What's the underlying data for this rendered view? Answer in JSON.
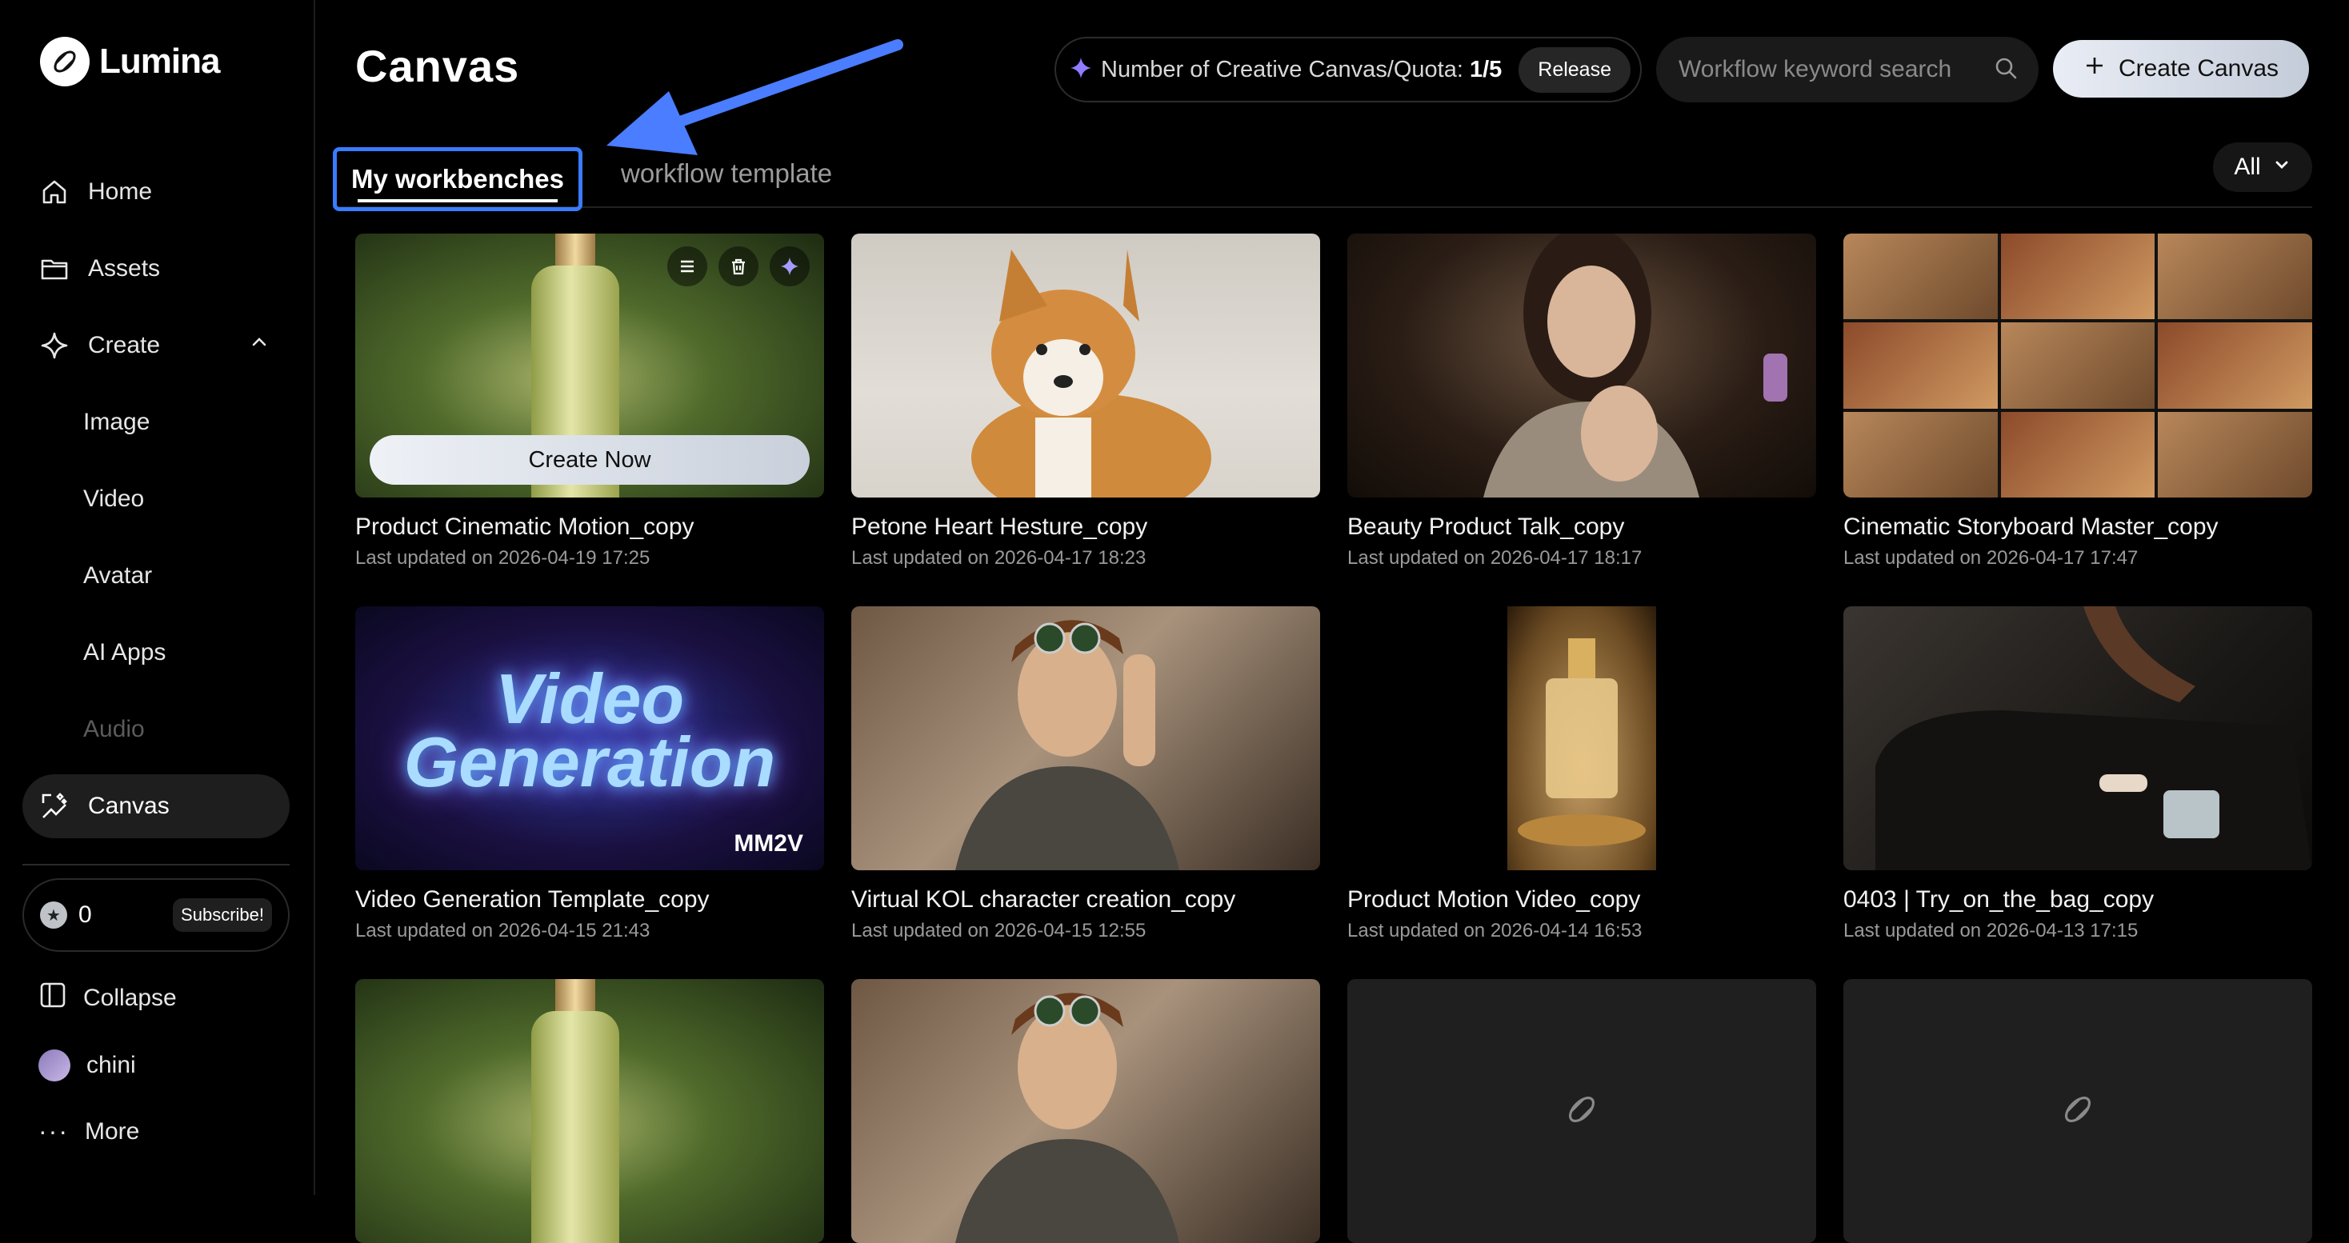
{
  "brand": {
    "name": "Lumina"
  },
  "sidebar": {
    "items": [
      {
        "label": "Home",
        "icon": "home-icon"
      },
      {
        "label": "Assets",
        "icon": "folder-icon"
      },
      {
        "label": "Create",
        "icon": "sparkle-icon"
      },
      {
        "label": "Image"
      },
      {
        "label": "Video"
      },
      {
        "label": "Avatar"
      },
      {
        "label": "AI Apps"
      },
      {
        "label": "Audio"
      },
      {
        "label": "Canvas",
        "icon": "canvas-icon"
      }
    ],
    "credits": {
      "count": "0",
      "subscribe_label": "Subscribe!"
    },
    "collapse_label": "Collapse",
    "user_name": "chini",
    "more_label": "More"
  },
  "header": {
    "title": "Canvas",
    "quota_label": "Number of Creative Canvas/Quota:",
    "quota_value": "1/5",
    "release_label": "Release",
    "search_placeholder": "Workflow keyword search",
    "create_label": "Create Canvas"
  },
  "tabs": {
    "active": "My workbenches",
    "inactive": "workflow template",
    "filter": "All"
  },
  "cards": [
    {
      "title": "Product Cinematic Motion_copy",
      "date": "Last updated on 2026-04-19 17:25",
      "action": "Create Now"
    },
    {
      "title": "Petone Heart Hesture_copy",
      "date": "Last updated on 2026-04-17 18:23"
    },
    {
      "title": "Beauty Product Talk_copy",
      "date": "Last updated on 2026-04-17 18:17"
    },
    {
      "title": "Cinematic Storyboard Master_copy",
      "date": "Last updated on 2026-04-17 17:47"
    },
    {
      "title": "Video Generation Template_copy",
      "date": "Last updated on 2026-04-15 21:43",
      "thumb_text": "Video Generation",
      "thumb_badge": "MM2V"
    },
    {
      "title": "Virtual KOL character creation_copy",
      "date": "Last updated on 2026-04-15 12:55"
    },
    {
      "title": "Product Motion Video_copy",
      "date": "Last updated on 2026-04-14 16:53"
    },
    {
      "title": "0403 | Try_on_the_bag_copy",
      "date": "Last updated on 2026-04-13 17:15"
    }
  ],
  "colors": {
    "accent": "#3a7bff",
    "background": "#000000",
    "sparkle": "#8f7cff"
  }
}
